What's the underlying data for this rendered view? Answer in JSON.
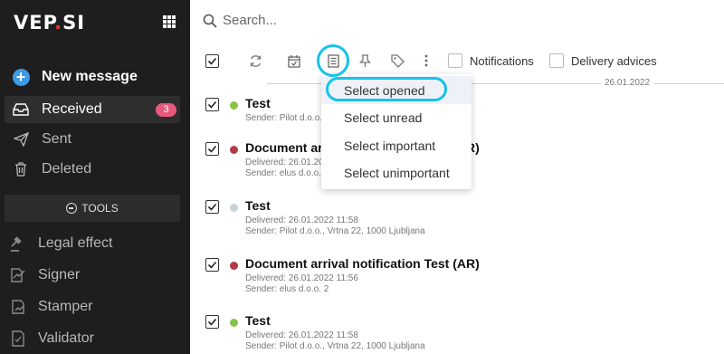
{
  "app": {
    "logo_main": "VEP",
    "logo_dot": ".",
    "logo_end": "SI"
  },
  "sidebar": {
    "new_message": "New message",
    "received": "Received",
    "received_count": "3",
    "sent": "Sent",
    "deleted": "Deleted",
    "tools": "TOOLS",
    "legal_effect": "Legal effect",
    "signer": "Signer",
    "stamper": "Stamper",
    "validator": "Validator"
  },
  "search": {
    "placeholder": "Search..."
  },
  "toolbar": {
    "notifications": "Notifications",
    "delivery_advices": "Delivery advices"
  },
  "date_separator": "26.01.2022",
  "dropdown": {
    "items": [
      "Select opened",
      "Select unread",
      "Select important",
      "Select unimportant"
    ]
  },
  "messages": [
    {
      "title": "Test",
      "status_color": "#8bc34a",
      "line1": "Sender: Pilot d.o.o.",
      "line2": ""
    },
    {
      "title": "Document arrival notification Test (AR)",
      "status_color": "#b03a48",
      "line1": "Delivered: 26.01.2022 11:56",
      "line2": "Sender: elus d.o.o. 2"
    },
    {
      "title": "Test",
      "status_color": "#c7d3da",
      "line1": "Delivered: 26.01.2022 11:58",
      "line2": "Sender: Pilot d.o.o., Vrtna 22, 1000 Ljubljana"
    },
    {
      "title": "Document arrival notification Test (AR)",
      "status_color": "#b03a48",
      "line1": "Delivered: 26.01.2022 11:56",
      "line2": "Sender: elus d.o.o. 2"
    },
    {
      "title": "Test",
      "status_color": "#8bc34a",
      "line1": "Delivered: 26.01.2022 11:58",
      "line2": "Sender: Pilot d.o.o., Vrtna 22, 1000 Ljubljana"
    }
  ],
  "colors": {
    "accent": "#14c3e8",
    "badge": "#e8587a",
    "sidebar_bg": "#1e1e1e",
    "new_message_icon": "#3b9be8"
  }
}
